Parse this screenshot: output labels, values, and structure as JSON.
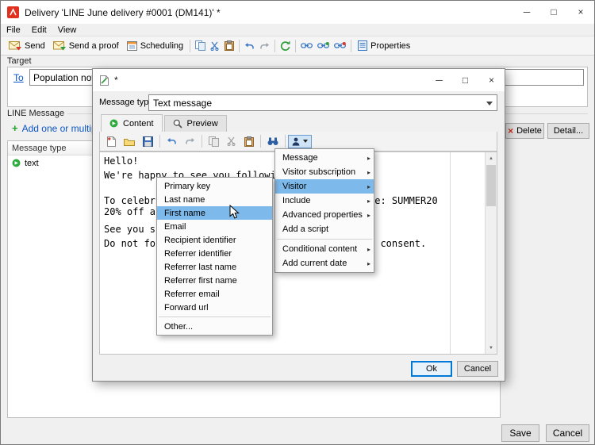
{
  "icons": {
    "minimize": "─",
    "maximize": "□",
    "close": "×",
    "scroll_up": "▲",
    "scroll_down": "▼",
    "plus": "+",
    "delete_x": "×"
  },
  "window": {
    "title": "Delivery 'LINE June delivery #0001 (DM141)' *",
    "menu_bar": {
      "items": [
        {
          "label": "File"
        },
        {
          "label": "Edit"
        },
        {
          "label": "View"
        }
      ]
    },
    "toolbar": {
      "send_label": "Send",
      "send_proof_label": "Send a proof",
      "scheduling_label": "Scheduling",
      "properties_label": "Properties"
    },
    "target": {
      "section_label": "Target",
      "to_label": "To",
      "population_value": "Population not def"
    },
    "line_message": {
      "section_label": "LINE Message",
      "add_link_label": "Add one or multipl...",
      "delete_label": "Delete",
      "detail_label": "Detail...",
      "column_header": "Message type",
      "rows": [
        {
          "type": "text"
        }
      ]
    },
    "footer": {
      "save_label": "Save",
      "cancel_label": "Cancel"
    }
  },
  "dialog": {
    "title": "*",
    "message_type_label": "Message type",
    "message_type_value": "Text message",
    "tabs": [
      {
        "label": "Content"
      },
      {
        "label": "Preview"
      }
    ],
    "editor": {
      "lines": [
        {
          "left": "Hello!",
          "right": ""
        },
        {
          "left": "We're happy to see you following us",
          "right": ""
        },
        {
          "left": "To celebr",
          "right": "te: SUMMER20"
        },
        {
          "left": "20% off a",
          "right": ""
        },
        {
          "left": "See you s",
          "right": ""
        },
        {
          "left": "Do not fo",
          "right": "t consent."
        }
      ]
    },
    "ok_label": "Ok",
    "cancel_label": "Cancel"
  },
  "insert_menu": {
    "items": [
      {
        "label": "Message",
        "arrow": "▸"
      },
      {
        "label": "Visitor subscription",
        "arrow": "▸"
      },
      {
        "label": "Visitor",
        "arrow": "▸"
      },
      {
        "label": "Include",
        "arrow": "▸"
      },
      {
        "label": "Advanced properties",
        "arrow": "▸"
      },
      {
        "label": "Add a script",
        "arrow": ""
      },
      {
        "label": "Conditional content",
        "arrow": "▸"
      },
      {
        "label": "Add current date",
        "arrow": "▸"
      }
    ]
  },
  "visitor_submenu": {
    "items": [
      {
        "label": "Primary key"
      },
      {
        "label": "Last name"
      },
      {
        "label": "First name"
      },
      {
        "label": "Email"
      },
      {
        "label": "Recipient identifier"
      },
      {
        "label": "Referrer identifier"
      },
      {
        "label": "Referrer last name"
      },
      {
        "label": "Referrer first name"
      },
      {
        "label": "Referrer email"
      },
      {
        "label": "Forward url"
      },
      {
        "label": "Other..."
      }
    ]
  }
}
